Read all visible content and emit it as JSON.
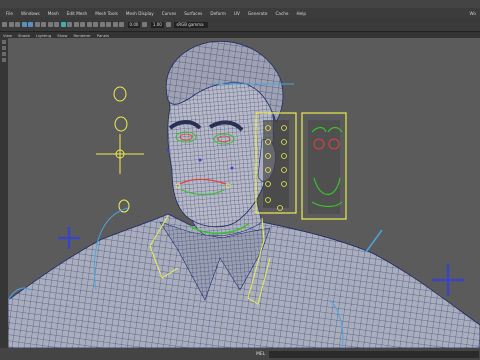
{
  "menu": {
    "items": [
      "File",
      "Windows",
      "Mesh",
      "Edit Mesh",
      "Mesh Tools",
      "Mesh Display",
      "Curves",
      "Surfaces",
      "Deform",
      "UV",
      "Generate",
      "Cache",
      "Help"
    ],
    "corner_label": "Wo"
  },
  "toolbar": {
    "field_a": "0.00",
    "field_b": "1.00",
    "camera_field": "sRGB gamma"
  },
  "panel": {
    "items": [
      "View",
      "Shade",
      "Lighting",
      "Show",
      "Renderer",
      "Panels"
    ]
  },
  "status": {
    "language_label": "MEL"
  },
  "colors": {
    "viewport_bg": "#5b5b5b",
    "wire": "#1f2a66",
    "rig_yellow": "#ecec50",
    "rig_blue": "#3a46c0",
    "rig_light_blue": "#47a6e0",
    "rig_green": "#38c030",
    "rig_red": "#e04040"
  }
}
